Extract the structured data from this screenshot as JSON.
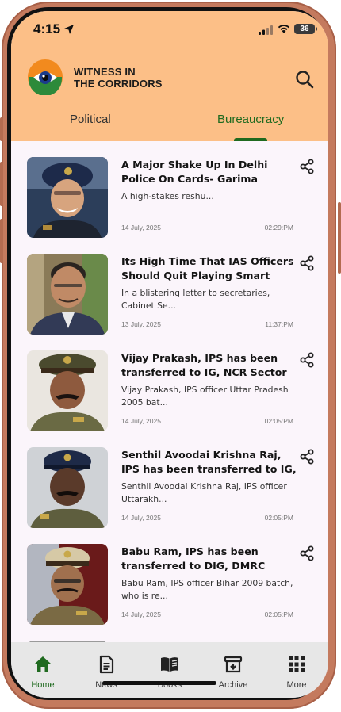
{
  "status_bar": {
    "time": "4:15",
    "battery": "36"
  },
  "brand": {
    "line1": "WITNESS IN",
    "line2": "THE CORRIDORS"
  },
  "tabs": [
    {
      "label": "Political",
      "active": false
    },
    {
      "label": "Bureaucracy",
      "active": true
    }
  ],
  "articles": [
    {
      "title": "A Major Shake Up In Delhi Police On Cards- Garima Bhatnagar",
      "snippet": "A high-stakes reshu...",
      "date": "14 July, 2025",
      "time": "02:29:PM"
    },
    {
      "title": "Its High Time That IAS Officers Should Quit Playing Smart While",
      "snippet": "In a blistering letter to secretaries, Cabinet Se...",
      "date": "13 July, 2025",
      "time": "11:37:PM"
    },
    {
      "title": "Vijay Prakash, IPS has been transferred to IG, NCR Sector HQ",
      "snippet": "Vijay Prakash, IPS officer Uttar Pradesh 2005 bat...",
      "date": "14 July, 2025",
      "time": "02:05:PM"
    },
    {
      "title": "Senthil Avoodai Krishna Raj, IPS has been transferred to IG, APS-I",
      "snippet": "Senthil Avoodai Krishna Raj, IPS officer Uttarakh...",
      "date": "14 July, 2025",
      "time": "02:05:PM"
    },
    {
      "title": "Babu Ram, IPS has been transferred to DIG, DMRC Delhi,",
      "snippet": "Babu Ram, IPS officer Bihar 2009 batch, who is re...",
      "date": "14 July, 2025",
      "time": "02:05:PM"
    }
  ],
  "nav": [
    {
      "label": "Home",
      "icon": "home-icon",
      "active": true
    },
    {
      "label": "News",
      "icon": "news-icon",
      "active": false
    },
    {
      "label": "Books",
      "icon": "books-icon",
      "active": false
    },
    {
      "label": "Archive",
      "icon": "archive-icon",
      "active": false
    },
    {
      "label": "More",
      "icon": "grid-icon",
      "active": false
    }
  ],
  "colors": {
    "header": "#fcbf87",
    "accent": "#1f6a1f",
    "nav_bg": "#e7e7e7",
    "frame": "#c47a5e"
  }
}
